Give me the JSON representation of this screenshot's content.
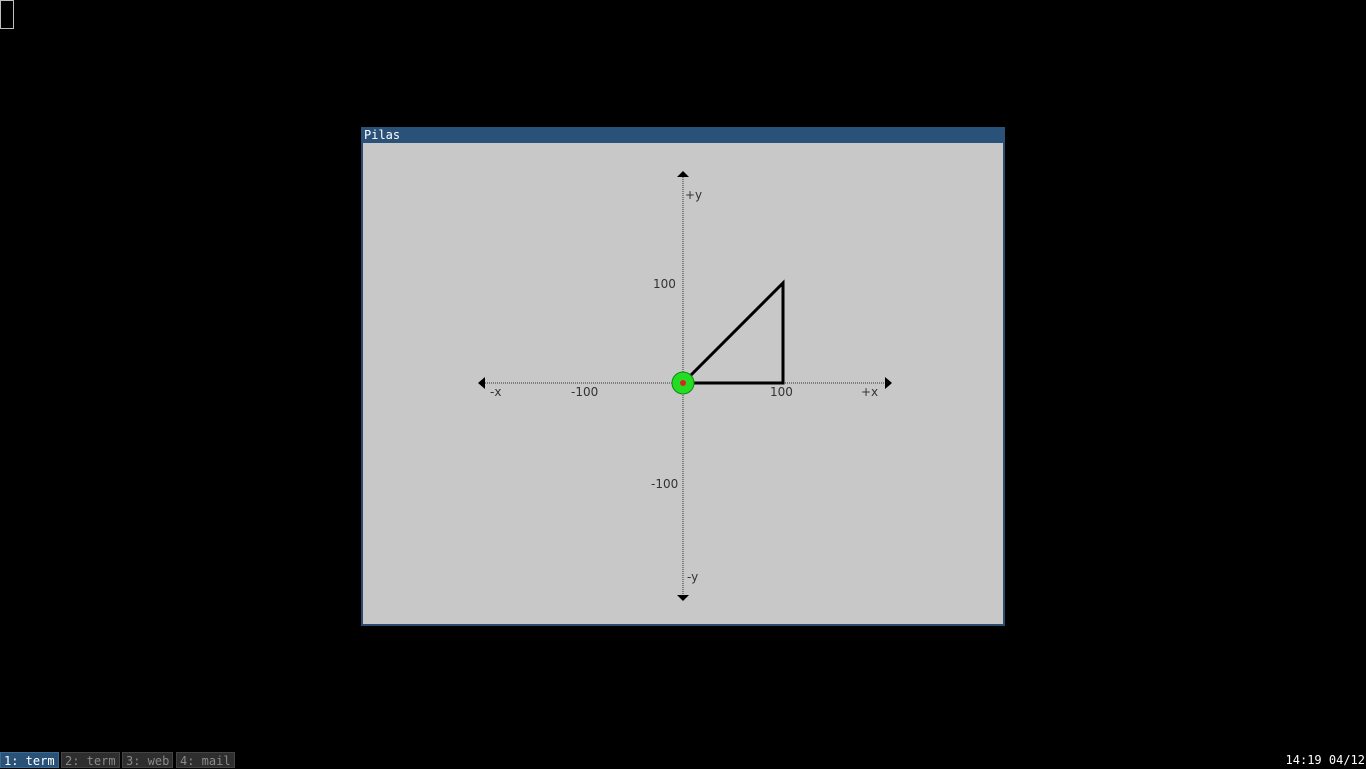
{
  "window": {
    "title": "Pilas"
  },
  "plot": {
    "axis_labels": {
      "plus_x": "+x",
      "minus_x": "-x",
      "plus_y": "+y",
      "minus_y": "-y"
    },
    "ticks": {
      "x_pos": "100",
      "x_neg": "-100",
      "y_pos": "100",
      "y_neg": "-100"
    },
    "triangle_vertices": [
      [
        0,
        0
      ],
      [
        100,
        0
      ],
      [
        100,
        100
      ]
    ],
    "actor_position": [
      0,
      0
    ],
    "colors": {
      "background": "#c8c8c8",
      "actor_fill": "#22dd22",
      "actor_center": "#dd2222"
    }
  },
  "taskbar": {
    "tabs": [
      {
        "label": "1: term",
        "active": true
      },
      {
        "label": "2: term",
        "active": false
      },
      {
        "label": "3: web",
        "active": false
      },
      {
        "label": "4: mail",
        "active": false
      }
    ],
    "clock": "14:19 04/12"
  }
}
